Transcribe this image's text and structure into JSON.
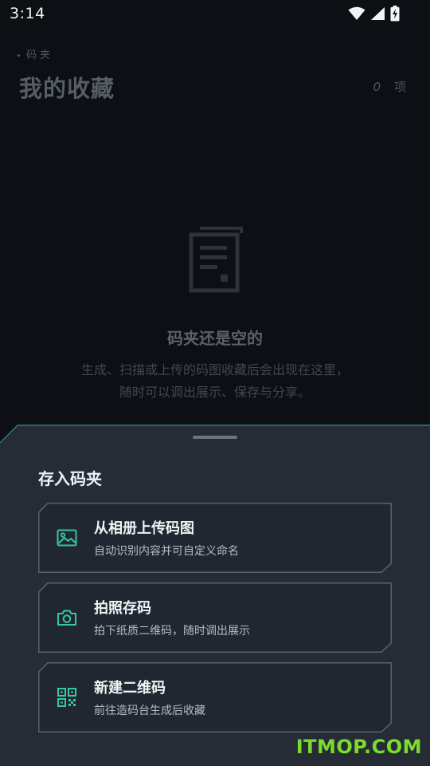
{
  "status_bar": {
    "time": "3:14"
  },
  "header": {
    "breadcrumb": "码夹",
    "title": "我的收藏",
    "count_value": "0",
    "count_unit": "项"
  },
  "empty_state": {
    "icon": "document-icon",
    "title": "码夹还是空的",
    "line1": "生成、扫描或上传的码图收藏后会出现在这里，",
    "line2": "随时可以调出展示、保存与分享。"
  },
  "sheet": {
    "title": "存入码夹",
    "options": [
      {
        "icon": "image-icon",
        "title": "从相册上传码图",
        "subtitle": "自动识别内容并可自定义命名"
      },
      {
        "icon": "camera-icon",
        "title": "拍照存码",
        "subtitle": "拍下纸质二维码，随时调出展示"
      },
      {
        "icon": "qr-code-icon",
        "title": "新建二维码",
        "subtitle": "前往造码台生成后收藏"
      }
    ]
  },
  "watermark": "ITMOP.COM",
  "colors": {
    "accent": "#35c7a8",
    "sheet_bg": "#252c36",
    "page_bg": "#0c0f13",
    "watermark": "#7bdc2e"
  }
}
